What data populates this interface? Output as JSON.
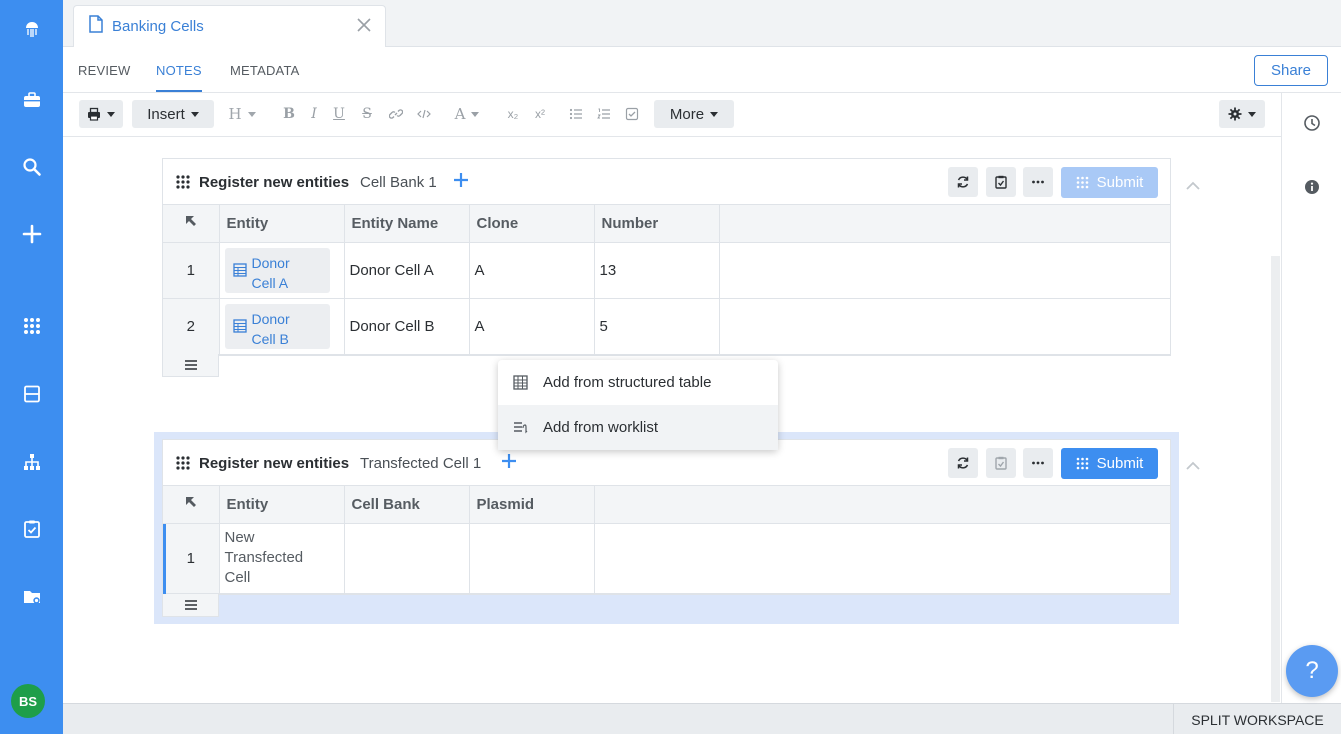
{
  "nav": {
    "items": [
      {
        "icon": "jellyfish-logo-icon"
      },
      {
        "icon": "briefcase-icon"
      },
      {
        "icon": "search-icon"
      },
      {
        "icon": "plus-icon"
      },
      {
        "icon": "apps-grid-icon"
      },
      {
        "icon": "inbox-icon"
      },
      {
        "icon": "hierarchy-icon"
      },
      {
        "icon": "clipboard-check-icon"
      },
      {
        "icon": "folder-settings-icon"
      }
    ],
    "avatar": "BS"
  },
  "tab": {
    "title": "Banking Cells"
  },
  "subtabs": {
    "review": "REVIEW",
    "notes": "NOTES",
    "metadata": "METADATA",
    "active": "NOTES"
  },
  "share_label": "Share",
  "toolbar": {
    "insert_label": "Insert",
    "heading_label": "H",
    "bold_label": "B",
    "italic_label": "I",
    "underline_label": "U",
    "strike_label": "S",
    "font_color_label": "A",
    "subscript_label": "x₂",
    "superscript_label": "x²",
    "more_label": "More"
  },
  "blocks": [
    {
      "title": "Register new entities",
      "schema": "Cell Bank 1",
      "submit_label": "Submit",
      "columns": [
        "Entity",
        "Entity Name",
        "Clone",
        "Number"
      ],
      "rows": [
        {
          "num": "1",
          "entity": "Donor Cell A",
          "entity_line1": "Donor",
          "entity_line2": "Cell A",
          "name": "Donor Cell A",
          "clone": "A",
          "number": "13"
        },
        {
          "num": "2",
          "entity": "Donor Cell B",
          "entity_line1": "Donor",
          "entity_line2": "Cell B",
          "name": "Donor Cell B",
          "clone": "A",
          "number": "5"
        }
      ]
    },
    {
      "title": "Register new entities",
      "schema": "Transfected Cell 1",
      "submit_label": "Submit",
      "columns": [
        "Entity",
        "Cell Bank",
        "Plasmid"
      ],
      "rows": [
        {
          "num": "1",
          "entity_line1": "New",
          "entity_line2": "Transfected",
          "entity_line3": "Cell",
          "cell_bank": "",
          "plasmid": ""
        }
      ]
    }
  ],
  "dropdown": {
    "items": [
      {
        "label": "Add from structured table",
        "icon": "table-icon"
      },
      {
        "label": "Add from worklist",
        "icon": "worklist-icon"
      }
    ]
  },
  "bottom": {
    "split_label": "SPLIT WORKSPACE"
  },
  "help_label": "?",
  "colors": {
    "accent": "#3d8ef0",
    "link": "#3a80d6",
    "avatar": "#1e9e4a"
  }
}
